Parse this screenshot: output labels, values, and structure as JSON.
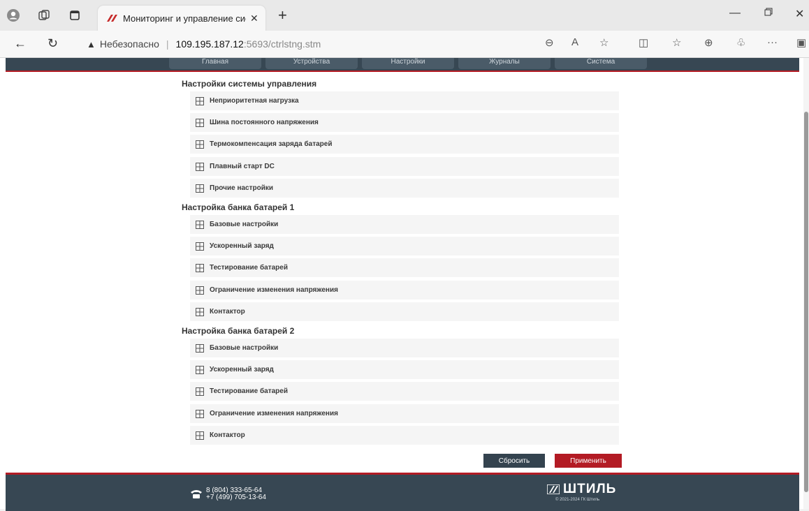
{
  "browser": {
    "tab_title": "Мониторинг и управление сист",
    "address": {
      "security_label": "Небезопасно",
      "host": "109.195.187.12",
      "path": ":5693/ctrlstng.stm"
    }
  },
  "topnav": {
    "items": [
      "Главная",
      "Устройства",
      "Настройки",
      "Журналы",
      "Система"
    ]
  },
  "groups": [
    {
      "title": "Настройки системы управления",
      "items": [
        "Неприоритетная нагрузка",
        "Шина постоянного напряжения",
        "Термокомпенсация заряда батарей",
        "Плавный старт DC",
        "Прочие настройки"
      ]
    },
    {
      "title": "Настройка банка батарей 1",
      "items": [
        "Базовые настройки",
        "Ускоренный заряд",
        "Тестирование батарей",
        "Ограничение изменения напряжения",
        "Контактор"
      ]
    },
    {
      "title": "Настройка банка батарей 2",
      "items": [
        "Базовые настройки",
        "Ускоренный заряд",
        "Тестирование батарей",
        "Ограничение изменения напряжения",
        "Контактор"
      ]
    }
  ],
  "actions": {
    "reset_label": "Сбросить",
    "apply_label": "Применить"
  },
  "footer": {
    "phone1": "8 (804) 333-65-64",
    "phone2": "+7 (499) 705-13-64",
    "brand": "ШТИЛЬ",
    "copyright": "© 2021-2024 ГК Штиль"
  },
  "colors": {
    "header_bg": "#374753",
    "accent_red": "#b31b24",
    "reset_button": "#34434f",
    "apply_button": "#b31b24"
  }
}
